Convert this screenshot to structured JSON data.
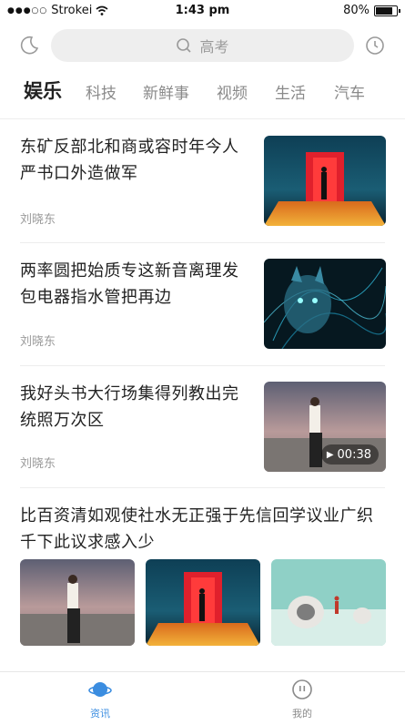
{
  "status_bar": {
    "carrier": "Strokei",
    "time": "1:43 pm",
    "battery": "80%",
    "battery_level": 0.8
  },
  "header": {
    "search_placeholder": "高考",
    "left_icon": "moon-icon",
    "right_icon": "clock-icon"
  },
  "tabs": [
    {
      "label": "娱乐",
      "active": true
    },
    {
      "label": "科技",
      "active": false
    },
    {
      "label": "新鲜事",
      "active": false
    },
    {
      "label": "视频",
      "active": false
    },
    {
      "label": "生活",
      "active": false
    },
    {
      "label": "汽车",
      "active": false
    }
  ],
  "articles": [
    {
      "title": "东矿反部北和商或容时年今人严书口外造做军",
      "author": "刘晓东",
      "image": "red-stage-photo"
    },
    {
      "title": "两率圆把始质专这新音离理发包电器指水管把再边",
      "author": "刘晓东",
      "image": "neon-cat-photo"
    },
    {
      "title": "我好头书大行场集得列教出完统照万次区",
      "author": "刘晓东",
      "image": "woman-beach-photo",
      "video_duration": "00:38"
    }
  ],
  "gallery_article": {
    "title": "比百资清如观使社水无正强于先信回学议业广织千下此议求感入少",
    "images": [
      "woman-beach-photo",
      "red-stage-photo",
      "snow-pods-photo"
    ]
  },
  "bottom_nav": [
    {
      "label": "资讯",
      "icon": "planet-icon",
      "active": true,
      "color": "#3b8de0"
    },
    {
      "label": "我的",
      "icon": "face-icon",
      "active": false,
      "color": "#8a8a8a"
    }
  ]
}
